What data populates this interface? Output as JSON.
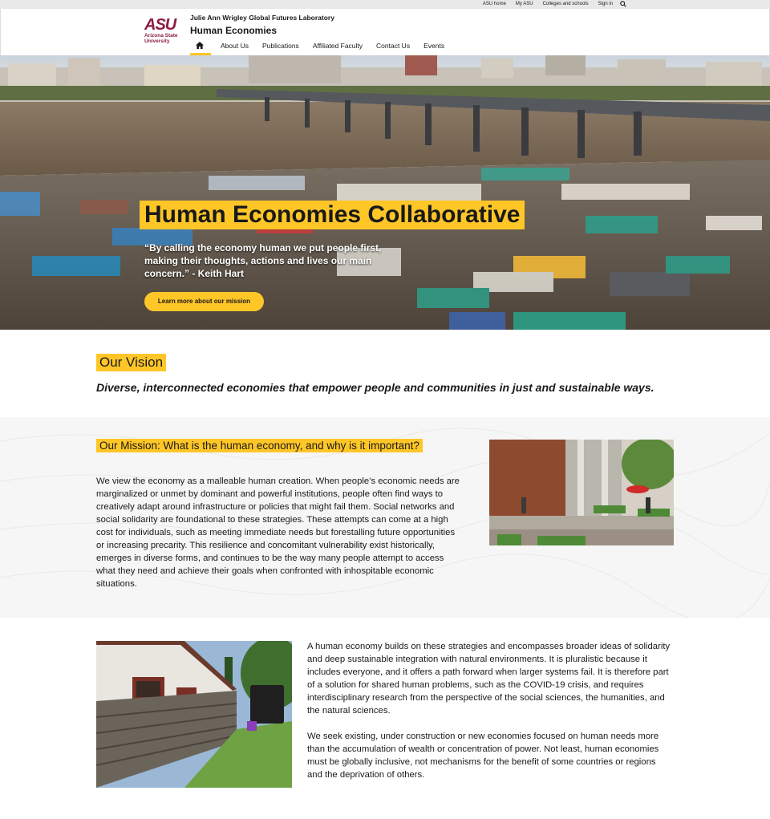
{
  "utility": {
    "links": [
      "ASU home",
      "My ASU",
      "Colleges and schools",
      "Sign in"
    ],
    "search_icon": "search-icon"
  },
  "header": {
    "logo_text": "ASU",
    "logo_sub_1": "Arizona State",
    "logo_sub_2": "University",
    "unit_name": "Julie Ann Wrigley Global Futures Laboratory",
    "site_title": "Human Economies",
    "home_icon": "home-icon",
    "nav": [
      "About Us",
      "Publications",
      "Affiliated Faculty",
      "Contact Us",
      "Events"
    ]
  },
  "hero": {
    "title": "Human Economies Collaborative",
    "quote": "“By calling the economy human we put people first, making their thoughts, actions and lives our main concern.” - Keith Hart",
    "button": "Learn more about our mission"
  },
  "vision": {
    "title": "Our Vision",
    "text": "Diverse, interconnected economies that empower people and communities in just and sustainable ways."
  },
  "mission": {
    "title": "Our Mission: What is the human economy, and why is it important?",
    "text": "We view the economy as a malleable human creation. When people’s economic needs are marginalized or unmet by dominant and powerful institutions, people often find ways to creatively adapt around infrastructure or policies that might fail them. Social networks and social solidarity are foundational to these strategies. These attempts can come at a high cost for individuals, such as meeting immediate needs but forestalling future opportunities or increasing precarity. This resilience and concomitant vulnerability exist historically, emerges in diverse forms, and continues to be the way many people attempt to access what they need and achieve their goals when confronted with inhospitable economic situations."
  },
  "lower": {
    "paragraph_1": "A human economy builds on these strategies and encompasses broader ideas of solidarity and deep sustainable integration with natural environments. It is pluralistic because it includes everyone, and it offers a path forward when larger systems fail. It is therefore part of a solution for shared human problems, such as the COVID-19 crisis, and requires interdisciplinary research from the perspective of the social sciences, the humanities, and the natural sciences.",
    "paragraph_2": "We seek existing, under construction or new economies focused on human needs more than the accumulation of wealth or concentration of power. Not least, human economies must be globally inclusive, not mechanisms for the benefit of some countries or regions and the deprivation of others."
  },
  "colors": {
    "gold": "#ffc627",
    "maroon": "#8c1d40",
    "text": "#191919"
  }
}
